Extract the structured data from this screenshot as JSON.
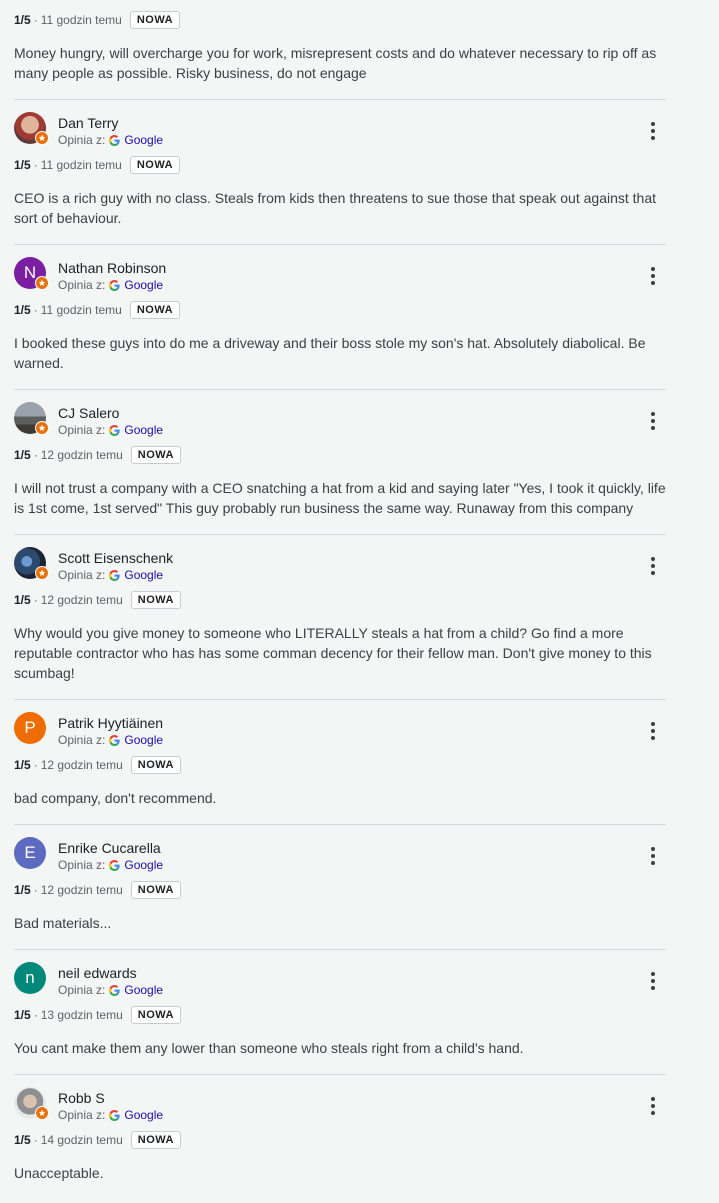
{
  "source_label": "Opinia z:",
  "google_label": "Google",
  "new_badge": "NOWA",
  "reviews": [
    {
      "name": "",
      "rating": "1/5",
      "time": "11 godzin temu",
      "text": "Money hungry, will overcharge you for work, misrepresent costs and do whatever necessary to rip off as many people as possible. Risky business, do not engage"
    },
    {
      "name": "Dan Terry",
      "rating": "1/5",
      "time": "11 godzin temu",
      "text": "CEO is a rich guy with no class. Steals from kids then threatens to sue those that speak out against that sort of behaviour.",
      "avatar": {
        "type": "photo",
        "color": "#a0524a"
      }
    },
    {
      "name": "Nathan Robinson",
      "rating": "1/5",
      "time": "11 godzin temu",
      "text": "I booked these guys into do me a driveway and their boss stole my son's hat. Absolutely diabolical. Be warned.",
      "avatar": {
        "type": "letter",
        "letter": "N",
        "color": "#7b1fa2"
      }
    },
    {
      "name": "CJ Salero",
      "rating": "1/5",
      "time": "12 godzin temu",
      "text": "I will not trust a company with a CEO snatching a hat from a kid and saying later \"Yes, I took it quickly, life is 1st come, 1st served\" This guy probably run business the same way. Runaway from this company",
      "avatar": {
        "type": "photo",
        "color": "#6d7278"
      }
    },
    {
      "name": "Scott Eisenschenk",
      "rating": "1/5",
      "time": "12 godzin temu",
      "text": "Why would you give money to someone who LITERALLY steals a hat from a child? Go find a more reputable contractor who has has some comman decency for their fellow man. Don't give money to this scumbag!",
      "avatar": {
        "type": "photo",
        "color": "#2c4a6e"
      }
    },
    {
      "name": "Patrik Hyytiäinen",
      "rating": "1/5",
      "time": "12 godzin temu",
      "text": "bad company, don't recommend.",
      "avatar": {
        "type": "letter",
        "letter": "P",
        "color": "#ef6c00"
      }
    },
    {
      "name": "Enrike Cucarella",
      "rating": "1/5",
      "time": "12 godzin temu",
      "text": "Bad materials...",
      "avatar": {
        "type": "letter",
        "letter": "E",
        "color": "#5c6bc0"
      }
    },
    {
      "name": "neil edwards",
      "rating": "1/5",
      "time": "13 godzin temu",
      "text": "You cant make them any lower than someone who steals right from a child's hand.",
      "avatar": {
        "type": "letter",
        "letter": "n",
        "color": "#00897b"
      }
    },
    {
      "name": "Robb S",
      "rating": "1/5",
      "time": "14 godzin temu",
      "text": "Unacceptable.",
      "avatar": {
        "type": "photo",
        "color": "#8d8f92"
      }
    }
  ]
}
